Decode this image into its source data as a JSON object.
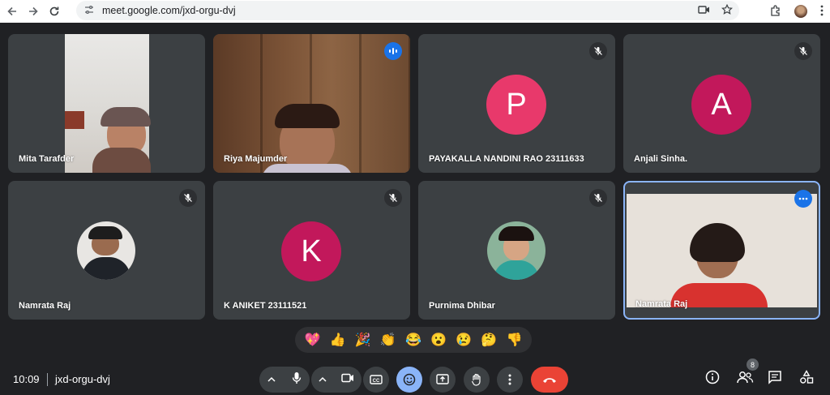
{
  "browser": {
    "url": "meet.google.com/jxd-orgu-dvj"
  },
  "tiles": [
    {
      "name": "Mita Tarafder"
    },
    {
      "name": "Riya Majumder"
    },
    {
      "name": "PAYAKALLA NANDINI RAO 23111633",
      "initial": "P",
      "avatar_color": "#e8396b"
    },
    {
      "name": "Anjali Sinha.",
      "initial": "A",
      "avatar_color": "#c2185b"
    },
    {
      "name": "Namrata Raj"
    },
    {
      "name": "K ANIKET 23111521",
      "initial": "K",
      "avatar_color": "#c2185b"
    },
    {
      "name": "Purnima Dhibar"
    },
    {
      "name": "Namrata Raj"
    }
  ],
  "reactions": [
    "💖",
    "👍",
    "🎉",
    "👏",
    "😂",
    "😮",
    "😢",
    "🤔",
    "👎"
  ],
  "bottom": {
    "time": "10:09",
    "meeting_code": "jxd-orgu-dvj",
    "participants_count": "8"
  },
  "colors": {
    "background": "#202124",
    "tile": "#3c4043",
    "active_border": "#8ab4f8",
    "end_call": "#ea4335",
    "emoji_active": "#8ab4f8",
    "speaking": "#1a73e8"
  }
}
